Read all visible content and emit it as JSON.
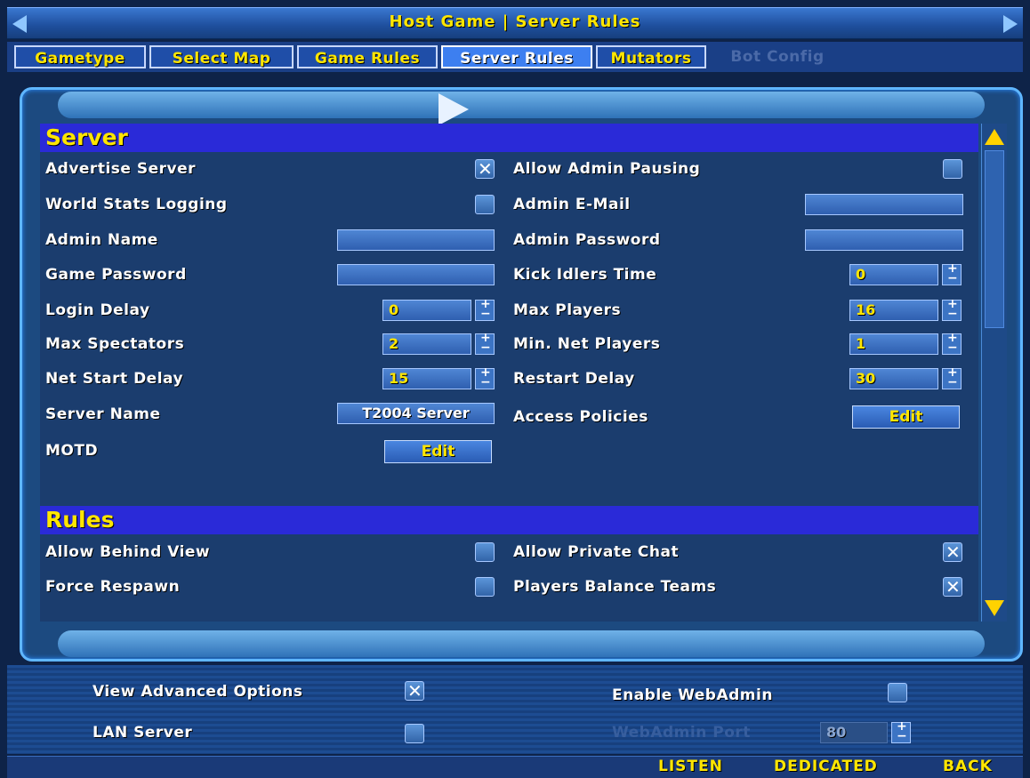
{
  "title": "Host Game | Server Rules",
  "tabs": [
    {
      "label": "Gametype"
    },
    {
      "label": "Select Map"
    },
    {
      "label": "Game Rules"
    },
    {
      "label": "Server Rules"
    },
    {
      "label": "Mutators"
    },
    {
      "label": "Bot Config"
    }
  ],
  "server": {
    "heading": "Server",
    "advertise_server": {
      "label": "Advertise Server",
      "checked": true
    },
    "allow_admin_pausing": {
      "label": "Allow Admin Pausing",
      "checked": false
    },
    "world_stats_logging": {
      "label": "World Stats Logging",
      "checked": false
    },
    "admin_email": {
      "label": "Admin E-Mail",
      "value": ""
    },
    "admin_name": {
      "label": "Admin Name",
      "value": ""
    },
    "admin_password": {
      "label": "Admin Password",
      "value": ""
    },
    "game_password": {
      "label": "Game Password",
      "value": ""
    },
    "kick_idlers_time": {
      "label": "Kick Idlers Time",
      "value": "0"
    },
    "login_delay": {
      "label": "Login Delay",
      "value": "0"
    },
    "max_players": {
      "label": "Max Players",
      "value": "16"
    },
    "max_spectators": {
      "label": "Max Spectators",
      "value": "2"
    },
    "min_net_players": {
      "label": "Min. Net Players",
      "value": "1"
    },
    "net_start_delay": {
      "label": "Net Start Delay",
      "value": "15"
    },
    "restart_delay": {
      "label": "Restart Delay",
      "value": "30"
    },
    "server_name": {
      "label": "Server Name",
      "value": "T2004 Server"
    },
    "access_policies": {
      "label": "Access Policies",
      "button": "Edit"
    },
    "motd": {
      "label": "MOTD",
      "button": "Edit"
    }
  },
  "rules": {
    "heading": "Rules",
    "allow_behind_view": {
      "label": "Allow Behind View",
      "checked": false
    },
    "allow_private_chat": {
      "label": "Allow Private Chat",
      "checked": true
    },
    "force_respawn": {
      "label": "Force Respawn",
      "checked": false
    },
    "players_balance_teams": {
      "label": "Players Balance Teams",
      "checked": true
    }
  },
  "bottom": {
    "view_advanced_options": {
      "label": "View Advanced Options",
      "checked": true
    },
    "enable_webadmin": {
      "label": "Enable WebAdmin",
      "checked": false
    },
    "lan_server": {
      "label": "LAN Server",
      "checked": false
    },
    "webadmin_port": {
      "label": "WebAdmin Port",
      "value": "80"
    }
  },
  "footer": {
    "listen": "LISTEN",
    "dedicated": "DEDICATED",
    "back": "BACK"
  },
  "colors": {
    "accent_yellow": "#ffe600",
    "section_blue": "#2a2ad8",
    "frame_cyan": "#5fb6ff"
  }
}
